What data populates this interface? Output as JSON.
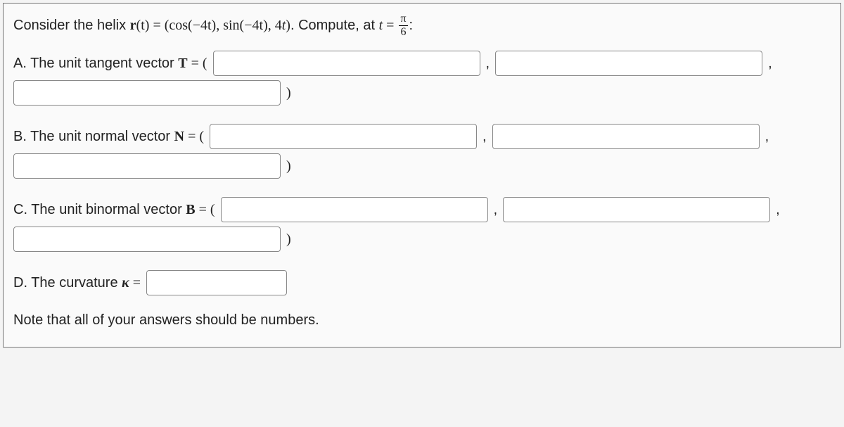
{
  "problem": {
    "intro_prefix": "Consider the helix ",
    "r_bold": "r",
    "r_arg": "(t)",
    "equals": " = ",
    "helix_open": "(cos(",
    "minus4t_1": "−4t",
    "helix_mid1": "), sin(",
    "minus4t_2": "−4t",
    "helix_mid2": "), 4",
    "t_tail": "t",
    "helix_close": ")",
    "compute_prefix": ". Compute, at ",
    "t_var": "t",
    "eq_sign": " = ",
    "frac_num": "π",
    "frac_den": "6",
    "colon": ":"
  },
  "parts": {
    "A": {
      "prefix": "A. The unit tangent vector ",
      "sym": "T",
      "after": " = ("
    },
    "B": {
      "prefix": "B. The unit normal vector ",
      "sym": "N",
      "after": " = ("
    },
    "C": {
      "prefix": "C. The unit binormal vector ",
      "sym": "B",
      "after": " = ("
    },
    "D": {
      "prefix": "D. The curvature ",
      "sym": "κ",
      "after": " ="
    }
  },
  "punct": {
    "comma": ",",
    "close_paren": ")"
  },
  "note": "Note that all of your answers should be numbers."
}
